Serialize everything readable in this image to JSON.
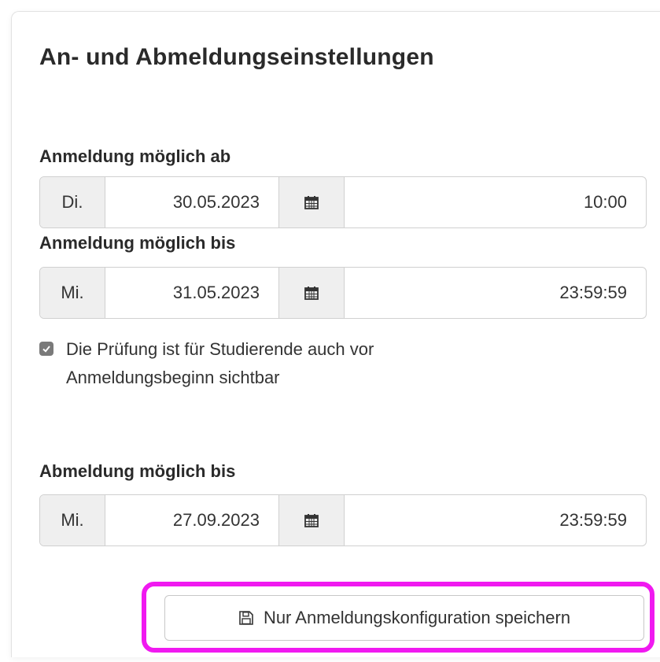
{
  "title": "An- und Abmeldungseinstellungen",
  "registration_from": {
    "label": "Anmeldung möglich ab",
    "day": "Di.",
    "date": "30.05.2023",
    "time": "10:00"
  },
  "registration_until": {
    "label": "Anmeldung möglich bis",
    "day": "Mi.",
    "date": "31.05.2023",
    "time": "23:59:59"
  },
  "visibility_checkbox": {
    "checked": true,
    "label": "Die Prüfung ist für Studierende auch vor Anmeldungsbeginn sichtbar"
  },
  "deregistration_until": {
    "label": "Abmeldung möglich bis",
    "day": "Mi.",
    "date": "27.09.2023",
    "time": "23:59:59"
  },
  "save_button": {
    "label": "Nur Anmeldungskonfiguration speichern",
    "icon": "floppy-disk-icon"
  },
  "colors": {
    "highlight": "#f019f0",
    "checkbox": "#7a7a7a"
  }
}
